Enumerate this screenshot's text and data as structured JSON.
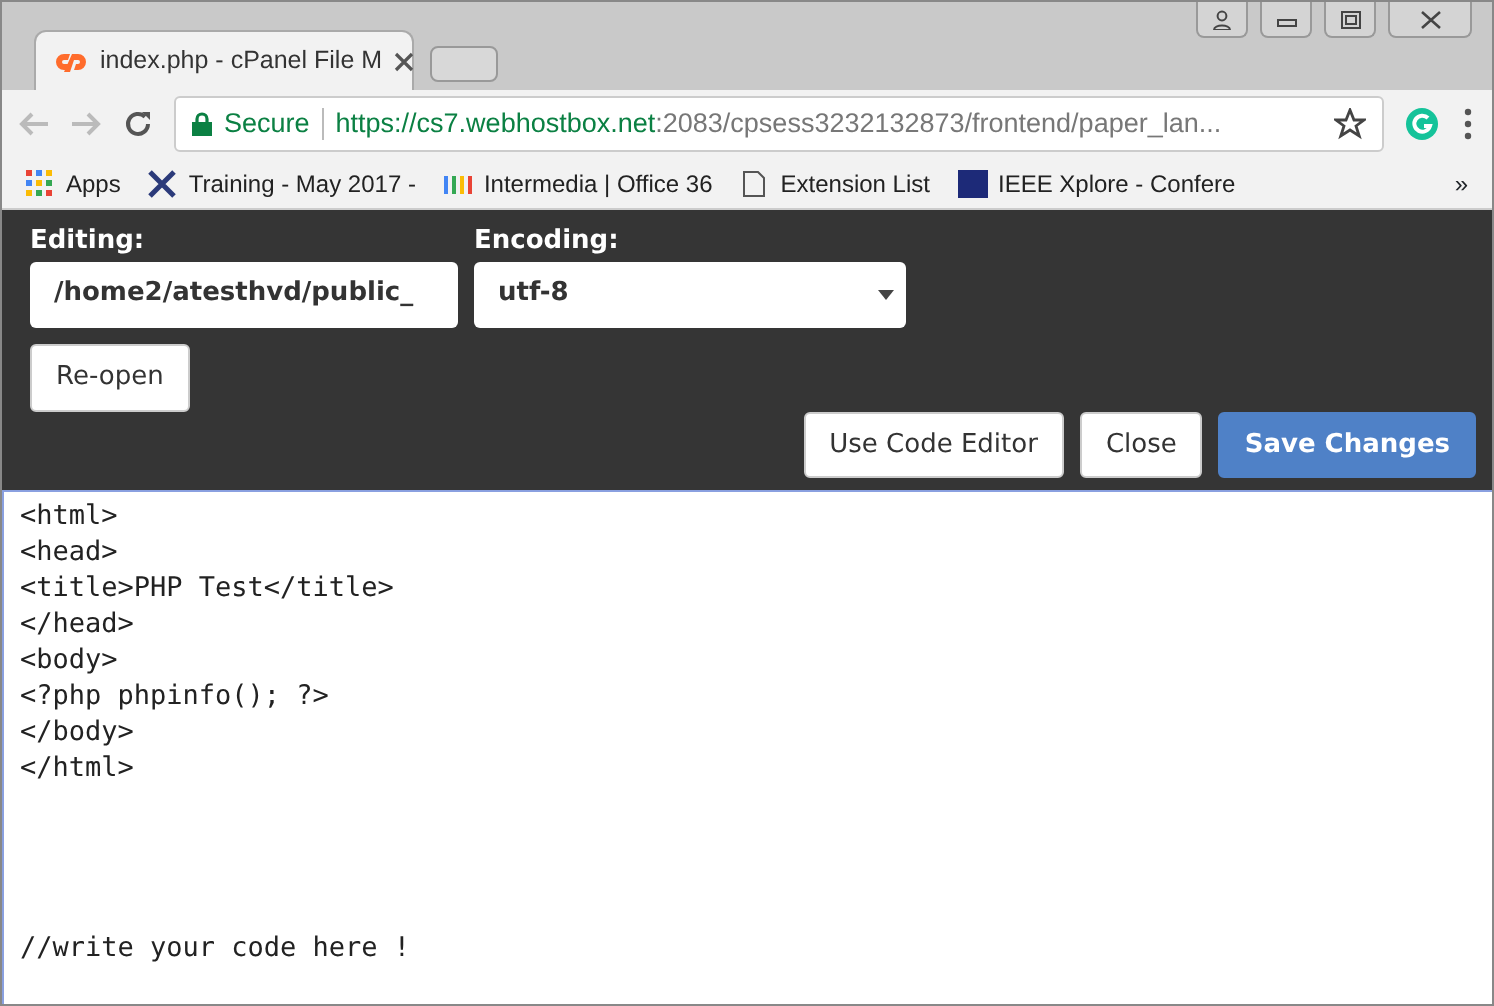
{
  "browser": {
    "tab_title": "index.php - cPanel File M",
    "security_label": "Secure",
    "url_host": "https://cs7.webhostbox.net",
    "url_rest": ":2083/cpsess3232132873/frontend/paper_lan...",
    "bookmarks": [
      {
        "kind": "apps",
        "label": "Apps"
      },
      {
        "kind": "training",
        "label": "Training - May 2017 -"
      },
      {
        "kind": "bars",
        "label": "Intermedia | Office 36"
      },
      {
        "kind": "page",
        "label": "Extension List"
      },
      {
        "kind": "ieee",
        "label": "IEEE Xplore - Confere"
      }
    ],
    "overflow": "»"
  },
  "editor_header": {
    "editing_label": "Editing:",
    "editing_value": "/home2/atesthvd/public_",
    "encoding_label": "Encoding:",
    "encoding_value": "utf-8",
    "reopen": "Re-open",
    "buttons": [
      {
        "label": "Use Code Editor",
        "primary": false
      },
      {
        "label": "Close",
        "primary": false
      },
      {
        "label": "Save Changes",
        "primary": true
      }
    ]
  },
  "code": "<html>\n<head>\n<title>PHP Test</title>\n</head>\n<body>\n<?php phpinfo(); ?>\n</body>\n</html>\n\n\n\n\n//write your code here !"
}
